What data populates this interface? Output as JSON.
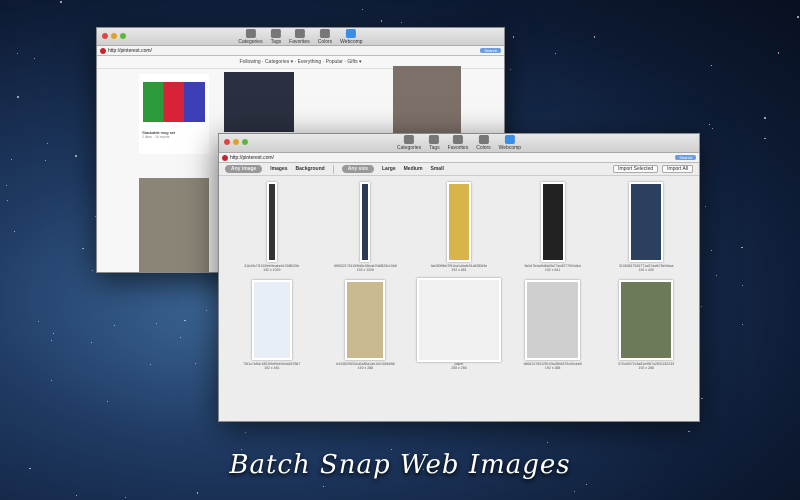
{
  "caption": "Batch Snap Web Images",
  "toolbar": {
    "items": [
      {
        "label": "Categories"
      },
      {
        "label": "Tags"
      },
      {
        "label": "Favorites"
      },
      {
        "label": "Colors"
      },
      {
        "label": "Webcomp"
      }
    ]
  },
  "back_window": {
    "url": "http://pinterest.com/",
    "go": "Search",
    "nav": "Following · Categories ▾ · Everything · Popular · Gifts ▾",
    "pin_title": "Stackable mug set",
    "pin_meta": "2 likes · 16 repins"
  },
  "front_window": {
    "url": "http://pinterest.com/",
    "go": "Search",
    "type_filters": [
      "Any image",
      "Images",
      "Background"
    ],
    "size_filters": [
      "Any size",
      "Large",
      "Medium",
      "Small"
    ],
    "import_selected": "Import Selected",
    "import_all": "Import All",
    "images": [
      {
        "name": "31b49c7f1192feb9eabeb109f8029e",
        "size": "192 x 1029",
        "color": "#333"
      },
      {
        "name": "6f55321751159fd6c3bbda7b6f825c10b8",
        "size": "192 x 1026",
        "color": "#2a3a55"
      },
      {
        "name": "fab3f0f9bb7f91ea1ddafe91a5383f4e",
        "size": "192 x 651",
        "color": "#d9b44a"
      },
      {
        "name": "5a0d7feda5d8a0fa77ac8377594dbd",
        "size": "192 x 641",
        "color": "#222"
      },
      {
        "name": "31060817526771a57dafb78e0feaa",
        "size": "192 x 400",
        "color": "#2b3f5e"
      },
      {
        "name": "75f1c7a5cb1851f9ef9eb9d4a547867",
        "size": "192 x 451",
        "color": "#e8eef5"
      },
      {
        "name": "b4438298334d2a85a1ab1b01565b58",
        "size": "192 x 288",
        "color": "#c9b98f"
      },
      {
        "name": "paper",
        "size": "256 x 256",
        "color": "#f0f0f0"
      },
      {
        "name": "b86414760425193a38b4875c90cbe8",
        "size": "192 x 288",
        "color": "#cfcfcf"
      },
      {
        "name": "07f1e6972c3a81e9f87a2831182239",
        "size": "192 x 288",
        "color": "#6d7a5a"
      }
    ]
  }
}
